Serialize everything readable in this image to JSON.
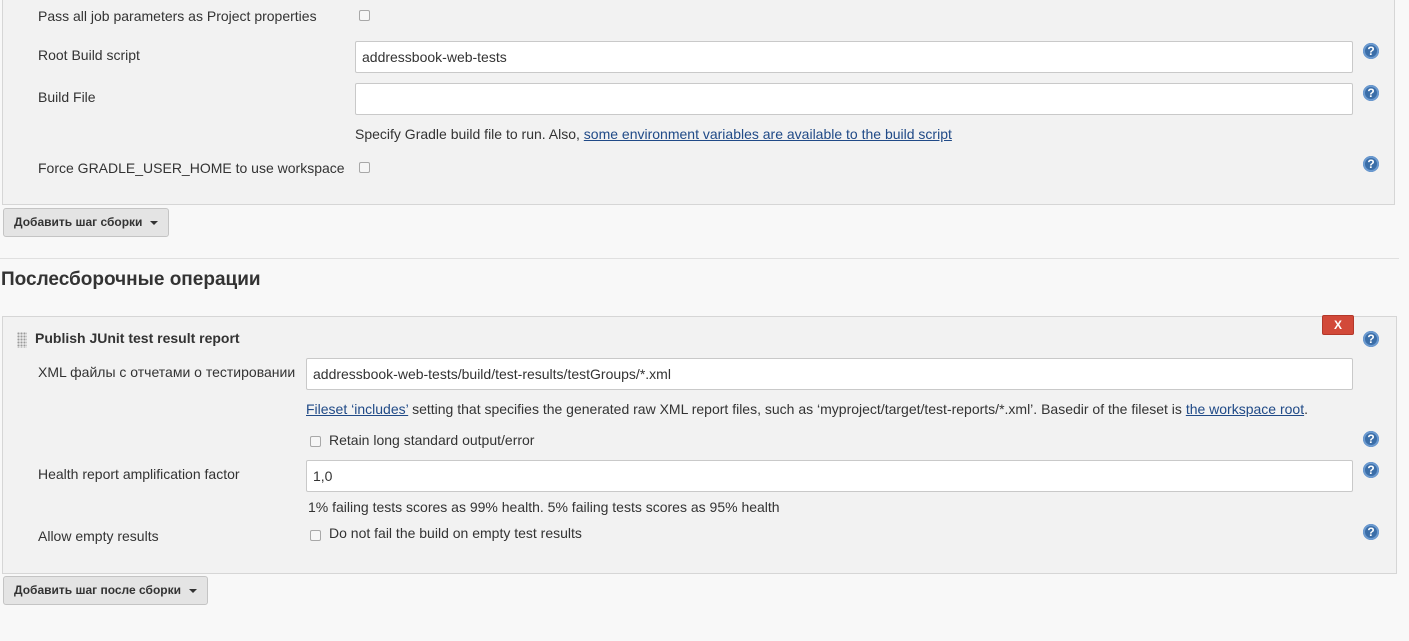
{
  "build_step": {
    "pass_params_label": "Pass all job parameters as Project properties",
    "root_script_label": "Root Build script",
    "root_script_value": "addressbook-web-tests",
    "build_file_label": "Build File",
    "build_file_value": "",
    "build_file_hint_prefix": "Specify Gradle build file to run. Also, ",
    "build_file_hint_link": "some environment variables are available to the build script",
    "force_home_label": "Force GRADLE_USER_HOME to use workspace",
    "add_step_button": "Добавить шаг сборки"
  },
  "post_build": {
    "section_title": "Послесборочные операции",
    "publisher_title": "Publish JUnit test result report",
    "close_label": "X",
    "xml_label": "XML файлы с отчетами о тестировании",
    "xml_value": "addressbook-web-tests/build/test-results/testGroups/*.xml",
    "xml_hint_link1": "Fileset ‘includes’",
    "xml_hint_middle": " setting that specifies the generated raw XML report files, such as ‘myproject/target/test-reports/*.xml’. Basedir of the fileset is ",
    "xml_hint_link2": "the workspace root",
    "xml_hint_end": ".",
    "retain_label": "Retain long standard output/error",
    "health_label": "Health report amplification factor",
    "health_value": "1,0",
    "health_hint": "1% failing tests scores as 99% health. 5% failing tests scores as 95% health",
    "allow_empty_label": "Allow empty results",
    "allow_empty_checkbox_label": "Do not fail the build on empty test results",
    "add_post_step_button": "Добавить шаг после сборки"
  },
  "icons": {
    "help": "?"
  },
  "colors": {
    "help_icon": "#3b6ea8",
    "delete_button": "#d24939",
    "link": "#204a87"
  }
}
